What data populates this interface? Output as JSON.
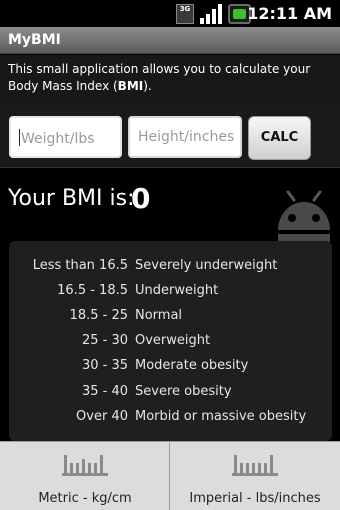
{
  "status_bar": {
    "network_badge": "3G",
    "time": "12:11 AM",
    "icons": [
      "network-3g-icon",
      "signal-strength-icon",
      "battery-icon"
    ]
  },
  "title_bar": {
    "title": "MyBMI"
  },
  "intro": {
    "text_before": "This small application allows you to calculate your Body Mass Index (",
    "text_bold": "BMI",
    "text_after": ")."
  },
  "form": {
    "weight_placeholder": "Weight/lbs",
    "height_placeholder": "Height/inches",
    "calc_label": "CALC"
  },
  "result": {
    "label": "Your BMI is:",
    "value": "0"
  },
  "bmi_table": [
    {
      "range": "Less than 16.5",
      "category": "Severely underweight"
    },
    {
      "range": "16.5 - 18.5",
      "category": "Underweight"
    },
    {
      "range": "18.5 - 25",
      "category": "Normal"
    },
    {
      "range": "25 - 30",
      "category": "Overweight"
    },
    {
      "range": "30 - 35",
      "category": "Moderate obesity"
    },
    {
      "range": "35 - 40",
      "category": "Severe obesity"
    },
    {
      "range": "Over 40",
      "category": "Morbid or massive obesity"
    }
  ],
  "tabs": [
    {
      "label": "Metric - kg/cm",
      "icon": "ruler-icon"
    },
    {
      "label": "Imperial - lbs/inches",
      "icon": "ruler-icon"
    }
  ],
  "colors": {
    "title_bar": "#6e6e6e",
    "background": "#000000",
    "battery_green": "#3fbf2e",
    "tab_bar": "#dcdcdc"
  }
}
